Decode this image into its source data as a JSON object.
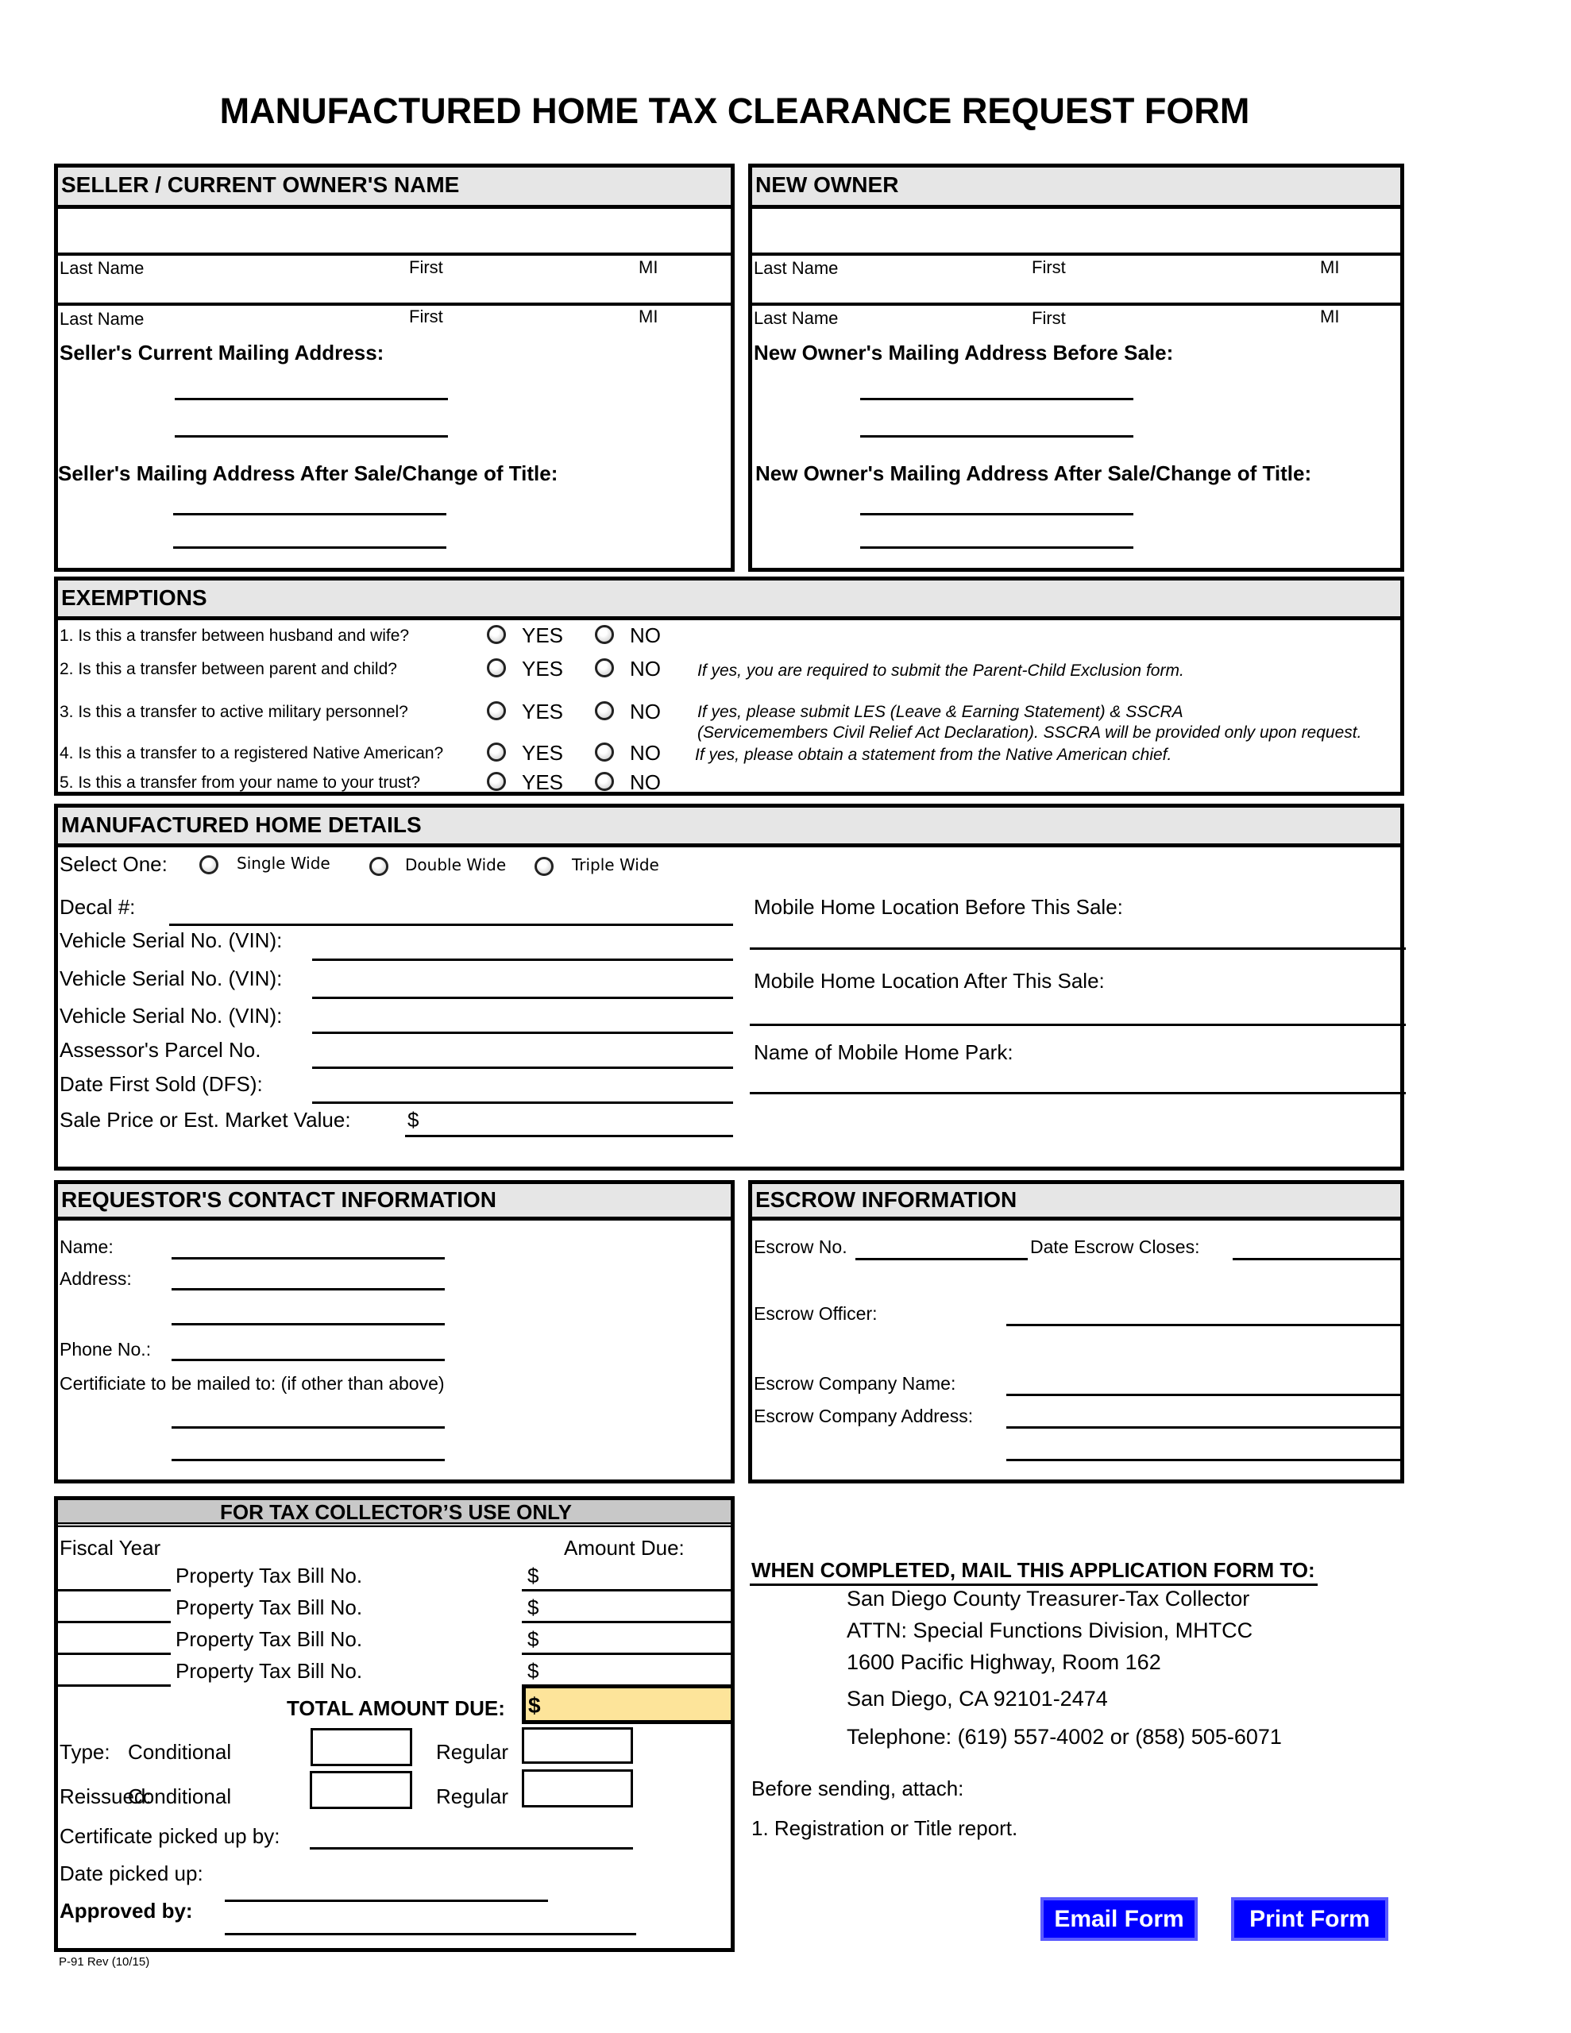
{
  "title": "MANUFACTURED HOME TAX CLEARANCE REQUEST FORM",
  "seller": {
    "header": "SELLER / CURRENT OWNER'S NAME",
    "last_name": "Last Name",
    "first": "First",
    "mi": "MI",
    "current_address": "Seller's Current Mailing Address:",
    "after_address": "Seller's Mailing Address After Sale/Change of Title:"
  },
  "new_owner": {
    "header": "NEW OWNER",
    "last_name": "Last Name",
    "first": "First",
    "mi": "MI",
    "before_address": "New Owner's Mailing Address Before Sale:",
    "after_address": "New Owner's Mailing Address After Sale/Change of Title:"
  },
  "exemptions": {
    "header": "EXEMPTIONS",
    "yes": "YES",
    "no": "NO",
    "questions": [
      {
        "q": "1. Is this a transfer between husband and wife?",
        "note": ""
      },
      {
        "q": "2. Is this a transfer between parent and child?",
        "note": "If yes, you are required to submit the Parent-Child Exclusion form."
      },
      {
        "q": "3. Is this a transfer to active military personnel?",
        "note": "If yes, please submit LES (Leave & Earning Statement) & SSCRA",
        "note2": "(Servicemembers Civil Relief Act Declaration). SSCRA will be provided only upon request."
      },
      {
        "q": "4. Is this a transfer to a registered Native American?",
        "note": "If yes, please obtain a statement from the Native American chief."
      },
      {
        "q": "5. Is this a transfer from your name to your trust?",
        "note": ""
      }
    ]
  },
  "home_details": {
    "header": "MANUFACTURED HOME DETAILS",
    "select_one": "Select One:",
    "options": [
      "Single Wide",
      "Double Wide",
      "Triple Wide"
    ],
    "decal": "Decal #:",
    "vin": "Vehicle Serial No. (VIN):",
    "parcel": "Assessor's Parcel No.",
    "dfs": "Date First Sold (DFS):",
    "sale_price": "Sale Price or Est. Market Value:",
    "dollar": "$",
    "loc_before": "Mobile Home Location Before This Sale:",
    "loc_after": "Mobile Home Location After This Sale:",
    "park": "Name of Mobile Home Park:"
  },
  "requestor": {
    "header": "REQUESTOR'S CONTACT INFORMATION",
    "name": "Name:",
    "address": "Address:",
    "phone": "Phone No.:",
    "certificate": "Certificiate to be mailed to: (if other than above)"
  },
  "escrow": {
    "header": "ESCROW INFORMATION",
    "no": "Escrow No.",
    "date_closes": "Date Escrow Closes:",
    "officer": "Escrow Officer:",
    "company_name": "Escrow Company Name:",
    "company_address": "Escrow Company Address:"
  },
  "tax_collector": {
    "header": "FOR TAX COLLECTOR’S USE ONLY",
    "fiscal_year": "Fiscal Year",
    "amount_due": "Amount Due:",
    "bill_label": "Property Tax Bill No.",
    "dollar": "$",
    "total": "TOTAL AMOUNT DUE:",
    "type": "Type:",
    "reissued": "Reissued:",
    "conditional": "Conditional",
    "regular": "Regular",
    "picked_by": "Certificate picked up by:",
    "date_picked": "Date picked up:",
    "approved": "Approved by:",
    "total_fill": "#fde49a"
  },
  "mail": {
    "heading": "WHEN COMPLETED, MAIL THIS APPLICATION FORM TO:",
    "lines": [
      "San Diego County Treasurer-Tax Collector",
      "ATTN: Special Functions Division, MHTCC",
      "1600 Pacific Highway, Room 162",
      "San Diego, CA 92101-2474",
      "Telephone: (619) 557-4002 or (858) 505-6071"
    ],
    "before_sending": "Before sending, attach:",
    "attach_1": "1. Registration or Title report."
  },
  "buttons": {
    "email": "Email Form",
    "print": "Print Form",
    "color": "#0000ff"
  },
  "footer": "P-91 Rev (10/15)"
}
